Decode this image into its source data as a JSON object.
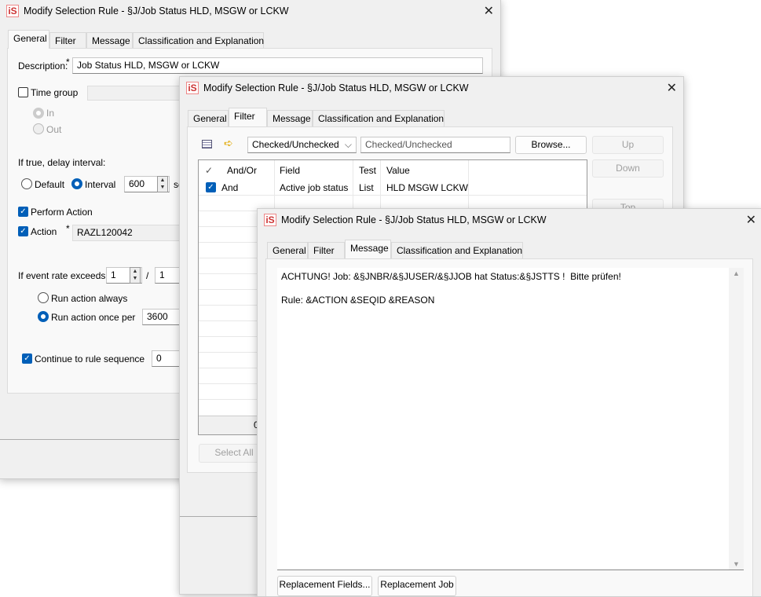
{
  "window_title": "Modify Selection Rule - §J/Job Status HLD, MSGW or LCKW",
  "logo": "iS",
  "tabs": [
    "General",
    "Filter",
    "Message",
    "Classification and Explanation"
  ],
  "general": {
    "description_label": "Description:",
    "required_mark": "*",
    "description_value": "Job Status HLD, MSGW or LCKW",
    "time_group_label": "Time group",
    "time_group_checked": false,
    "in_label": "In",
    "out_label": "Out",
    "delay_label": "If true, delay interval:",
    "default_label": "Default",
    "interval_label": "Interval",
    "interval_value": "600",
    "interval_unit": "se",
    "perform_action_label": "Perform Action",
    "perform_action_checked": true,
    "action_label": "Action",
    "action_value": "RAZL120042",
    "action_checked": true,
    "event_rate_label": "If event rate exceeds",
    "event_rate_value": "1",
    "slash": "/",
    "event_rate_per": "1",
    "run_always_label": "Run action always",
    "run_once_label": "Run action once per",
    "run_once_value": "3600",
    "continue_label": "Continue to rule sequence",
    "continue_value": "0",
    "continue_checked": true
  },
  "filter": {
    "combo_value": "Checked/Unchecked",
    "value_input": "Checked/Unchecked",
    "browse_label": "Browse...",
    "up_label": "Up",
    "down_label": "Down",
    "top_label": "Top",
    "columns": [
      "✓",
      "And/Or",
      "Field",
      "Test",
      "Value"
    ],
    "rows": [
      {
        "checked": true,
        "andor": "And",
        "field": "Active job status",
        "test": "List",
        "value": "HLD MSGW LCKW"
      }
    ],
    "footer_count": "0",
    "select_all_label": "Select All"
  },
  "message": {
    "line1": "ACHTUNG! Job: &§JNBR/&§JUSER/&§JJOB hat Status:&§JSTTS !  Bitte prüfen!",
    "line2": "Rule: &ACTION &SEQID &REASON",
    "replacement_fields_label": "Replacement Fields...",
    "replacement_job_label": "Replacement Job"
  },
  "colors": {
    "accent": "#005fb8",
    "logo": "#cc3333"
  }
}
